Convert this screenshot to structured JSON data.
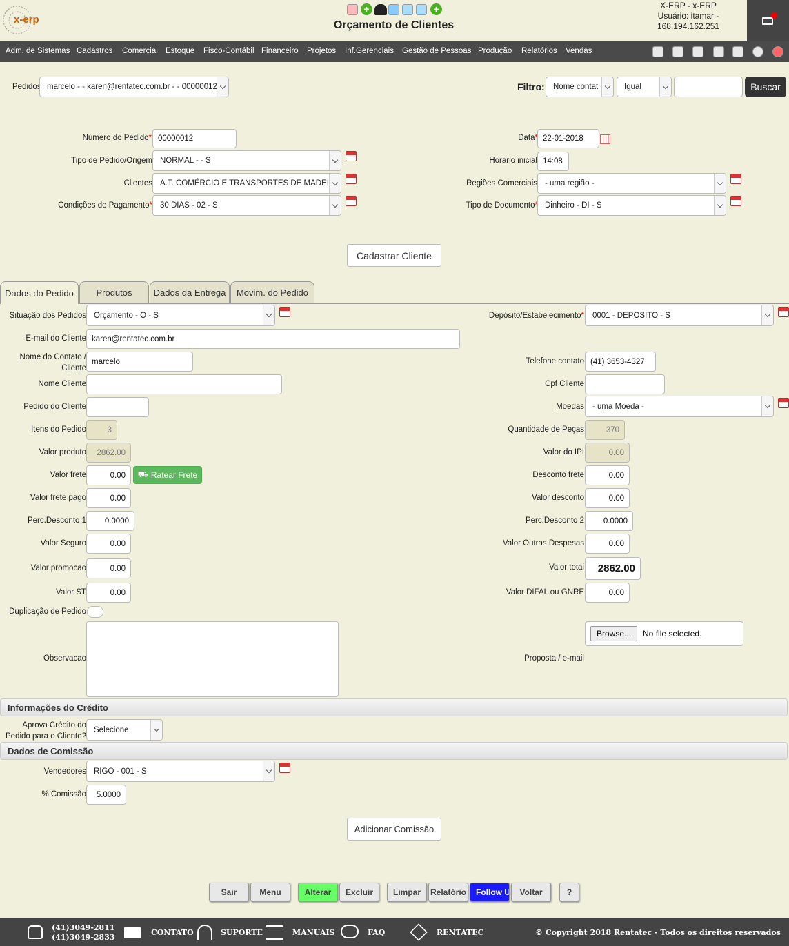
{
  "header": {
    "logo_text": "x-erp",
    "title": "Orçamento de Clientes",
    "user_line1": "X-ERP - x-ERP",
    "user_line2": "Usuário: itamar -",
    "user_line3": "168.194.162.251"
  },
  "menu": [
    "Adm. de Sistemas",
    "Cadastros",
    "Comercial",
    "Estoque",
    "Fisco-Contábil",
    "Financeiro",
    "Projetos",
    "Inf.Gerenciais",
    "Gestão de Pessoas",
    "Produção",
    "Relatórios",
    "Vendas"
  ],
  "search": {
    "pedidos_label": "Pedidos",
    "pedidos_value": "marcelo - - karen@rentatec.com.br - - 00000012",
    "filtro_label": "Filtro:",
    "filtro_field": "Nome contat",
    "filtro_op": "Igual",
    "filtro_value": "",
    "buscar": "Buscar"
  },
  "order": {
    "numero_label": "Número do Pedido",
    "numero": "00000012",
    "tipo_label": "Tipo de Pedido/Origem",
    "tipo": "NORMAL - - S",
    "clientes_label": "Clientes",
    "clientes": "A.T. COMÉRCIO E TRANSPORTES DE MADEIRAS LTDA",
    "condicoes_label": "Condições de Pagamento",
    "condicoes": "30 DIAS - 02 - S",
    "data_label": "Data",
    "data": "22-01-2018",
    "horario_label": "Horario inicial",
    "horario": "14:08",
    "regioes_label": "Regiões Comerciais",
    "regioes": "- uma região -",
    "tipodoc_label": "Tipo de Documento",
    "tipodoc": "Dinheiro - DI - S",
    "cadastrar": "Cadastrar Cliente"
  },
  "tabs": [
    "Dados do Pedido",
    "Produtos",
    "Dados da Entrega",
    "Movim. do Pedido"
  ],
  "fields": {
    "situacao_label": "Situação dos Pedidos",
    "situacao": "Orçamento - O - S",
    "deposito_label": "Depósito/Estabelecimento",
    "deposito": "0001 - DEPOSITO - S",
    "email_label": "E-mail do Cliente",
    "email": "karen@rentatec.com.br",
    "contato_label1": "Nome do Contato /",
    "contato_label2": "Cliente",
    "contato": "marcelo",
    "telefone_label": "Telefone contato",
    "telefone": "(41) 3653-4327",
    "nome_label": "Nome Cliente",
    "nome": "",
    "cpf_label": "Cpf Cliente",
    "cpf": "",
    "pedido_cliente_label": "Pedido do Cliente",
    "pedido_cliente": "",
    "moedas_label": "Moedas",
    "moedas": "- uma Moeda -",
    "itens_label": "Itens do Pedido",
    "itens": "3",
    "qtd_label": "Quantidade de Peças",
    "qtd": "370",
    "valor_produto_label": "Valor produto",
    "valor_produto": "2862.00",
    "ipi_label": "Valor do IPI",
    "ipi": "0.00",
    "frete_label": "Valor frete",
    "frete": "0.00",
    "ratear": "Ratear Frete",
    "desc_frete_label": "Desconto frete",
    "desc_frete": "0.00",
    "frete_pago_label": "Valor frete pago",
    "frete_pago": "0.00",
    "valor_desconto_label": "Valor desconto",
    "valor_desconto": "0.00",
    "perc1_label": "Perc.Desconto 1",
    "perc1": "0.0000",
    "perc2_label": "Perc.Desconto 2",
    "perc2": "0.0000",
    "seguro_label": "Valor Seguro",
    "seguro": "0.00",
    "outras_label": "Valor Outras Despesas",
    "outras": "0.00",
    "promocao_label": "Valor promocao",
    "promocao": "0.00",
    "total_label": "Valor total",
    "total": "2862.00",
    "st_label": "Valor ST",
    "st": "0.00",
    "difal_label": "Valor DIFAL ou GNRE",
    "difal": "0.00",
    "duplicacao_label": "Duplicação de Pedido",
    "observacao_label": "Observacao",
    "browse": "Browse...",
    "no_file": "No file selected.",
    "proposta_label": "Proposta / e-mail"
  },
  "credito": {
    "title": "Informações do Crédito",
    "aprova_label1": "Aprova Crédito do",
    "aprova_label2": "Pedido para o Cliente?",
    "aprova": "Selecione"
  },
  "comissao": {
    "title": "Dados de Comissão",
    "vendedores_label": "Vendedores",
    "vendedores": "RIGO - 001 - S",
    "perc_label": "% Comissão",
    "perc": "5.0000",
    "adicionar": "Adicionar Comissão"
  },
  "actions": {
    "sair": "Sair",
    "menu": "Menu",
    "alterar": "Alterar",
    "excluir": "Excluir",
    "limpar": "Limpar",
    "relatorio": "Relatório",
    "follow": "Follow Up",
    "voltar": "Voltar",
    "help": "?"
  },
  "footer": {
    "phone1": "(41)3049-2811",
    "phone2": "(41)3049-2833",
    "contato": "CONTATO",
    "suporte": "SUPORTE",
    "manuais": "MANUAIS",
    "faq": "FAQ",
    "rentatec": "RENTATEC",
    "copyright": "© Copyright 2018 Rentatec - Todos os direitos reservados"
  },
  "colors": {
    "accent_green": "#5cb85c",
    "alterar": "#66ff66",
    "follow": "#1a1aff",
    "topbar": "#4a4a4a"
  }
}
